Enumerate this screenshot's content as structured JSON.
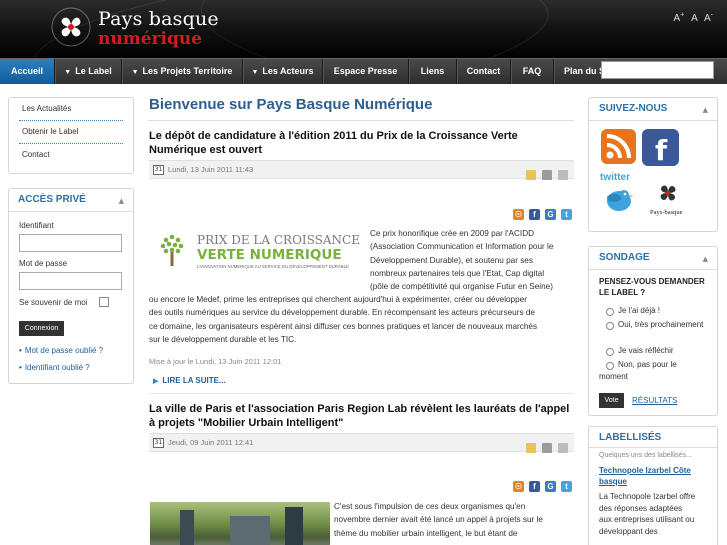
{
  "header": {
    "logo_line1": "Pays basque",
    "logo_line2": "numérique",
    "font_controls": [
      "A+",
      "A",
      "A-"
    ]
  },
  "nav": {
    "items": [
      {
        "label": "Accueil",
        "active": true
      },
      {
        "label": "Le Label",
        "dropdown": true
      },
      {
        "label": "Les Projets Territoire",
        "dropdown": true
      },
      {
        "label": "Les Acteurs",
        "dropdown": true
      },
      {
        "label": "Espace Presse"
      },
      {
        "label": "Liens"
      },
      {
        "label": "Contact"
      },
      {
        "label": "FAQ"
      },
      {
        "label": "Plan du Site"
      }
    ],
    "search_placeholder": ""
  },
  "left": {
    "menu": [
      "Les Actualités",
      "Obtenir le Label",
      "Contact"
    ],
    "login": {
      "title": "ACCÈS PRIVÉ",
      "username_label": "Identifiant",
      "password_label": "Mot de passe",
      "remember_label": "Se souvenir de moi",
      "button": "Connexion",
      "links": [
        "Mot de passe oublié ?",
        "Identifiant oublié ?"
      ]
    }
  },
  "main": {
    "page_title": "Bienvenue sur Pays Basque Numérique",
    "articles": [
      {
        "title": "Le dépôt de candidature à l'édition 2011 du Prix de la Croissance Verte Numérique est ouvert",
        "date": "Lundi, 13 Juin 2011 11:43",
        "image_text": {
          "line1": "PRIX DE LA CROISSANCE",
          "line2": "VERTE NUMERIQUE",
          "line3": "L'INNOVATION NUMERIQUE AU SERVICE DU DÉVELOPPEMENT DURABLE"
        },
        "body_right": [
          "Ce prix honorifique crée en 2009 par l'ACIDD",
          "(Association Communication et Information pour le",
          "Développement Durable), et soutenu par ses",
          "nombreux partenaires tels que l'Etat, Cap digital",
          "(pôle de compétitivité qui organise Futur en Seine)"
        ],
        "body_full": [
          "ou encore le Medef, prime les entreprises qui cherchent aujourd'hui à expérimenter, créer ou développer",
          "des outils numériques au service du développement durable. En récompensant les acteurs précurseurs de",
          "ce domaine, les organisateurs espèrent ainsi diffuser ces bonnes pratiques et lancer de nouveaux marchés",
          "sur le développement durable et les TIC."
        ],
        "modified": "Mise à jour le Lundi, 13 Juin 2011 12:01",
        "readmore": "LIRE LA SUITE..."
      },
      {
        "title": "La ville de Paris et l'association Paris Region Lab révèlent les lauréats de l'appel à projets \"Mobilier Urbain Intelligent\"",
        "date": "Jeudi, 09 Juin 2011 12:41",
        "body_right": [
          "C'est sous l'impulsion de ces deux organismes qu'en",
          "novembre dernier avait été lancé un appel à projets sur le",
          "thème du mobilier urbain intelligent, le but étant de"
        ]
      }
    ]
  },
  "right": {
    "follow": {
      "title": "SUIVEZ-NOUS",
      "twitter_text": "twitter",
      "pbn_caption": "Pays-basque"
    },
    "poll": {
      "title": "SONDAGE",
      "question": "PENSEZ-VOUS DEMANDER LE LABEL ?",
      "options": [
        "Je l'ai déjà !",
        "Oui, très prochainement",
        "Je vais réfléchir",
        "Non, pas pour le moment"
      ],
      "vote": "Vote",
      "results": "RÉSULTATS"
    },
    "labellises": {
      "title": "LABELLISÉS",
      "small": "Quelques uns des labellisés...",
      "link": "Technopole Izarbel Côte basque",
      "text": [
        "La Technopole Izarbel offre",
        "des réponses adaptées",
        "aux entreprises utilisant ou",
        "développant des"
      ]
    }
  },
  "colors": {
    "accent_blue": "#2e6fa4",
    "nav_active": "#1a6aad",
    "logo_red": "#d01c1f",
    "title_blue": "#2e5f8e"
  }
}
